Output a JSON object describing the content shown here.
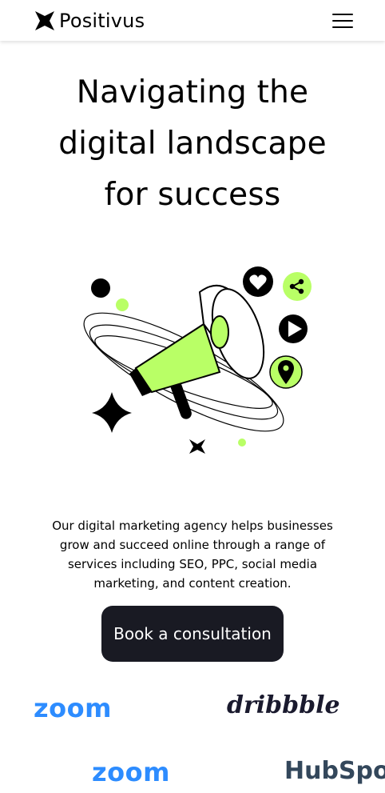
{
  "header": {
    "brand_name": "Positivus",
    "menu_icon": "hamburger-menu-icon"
  },
  "hero": {
    "title_lines": [
      "Navigating the",
      "digital landscape",
      "for success"
    ],
    "illustration_icons": [
      "megaphone-icon",
      "heart-icon",
      "share-icon",
      "play-icon",
      "location-pin-icon",
      "sparkle-star-icon"
    ],
    "description_lines": [
      "Our digital marketing agency helps businesses",
      "grow and succeed online through a range of",
      "services including SEO, PPC, social media",
      "marketing, and content creation."
    ],
    "cta_label": "Book a consultation"
  },
  "logos": {
    "row1": [
      "zoom",
      "dribbble"
    ],
    "row2": [
      "zoom",
      "HubSpot"
    ]
  },
  "colors": {
    "accent": "#b9ff66",
    "dark": "#191a23",
    "zoom_blue": "#2d8cff",
    "hubspot_orange": "#ff7a59"
  }
}
